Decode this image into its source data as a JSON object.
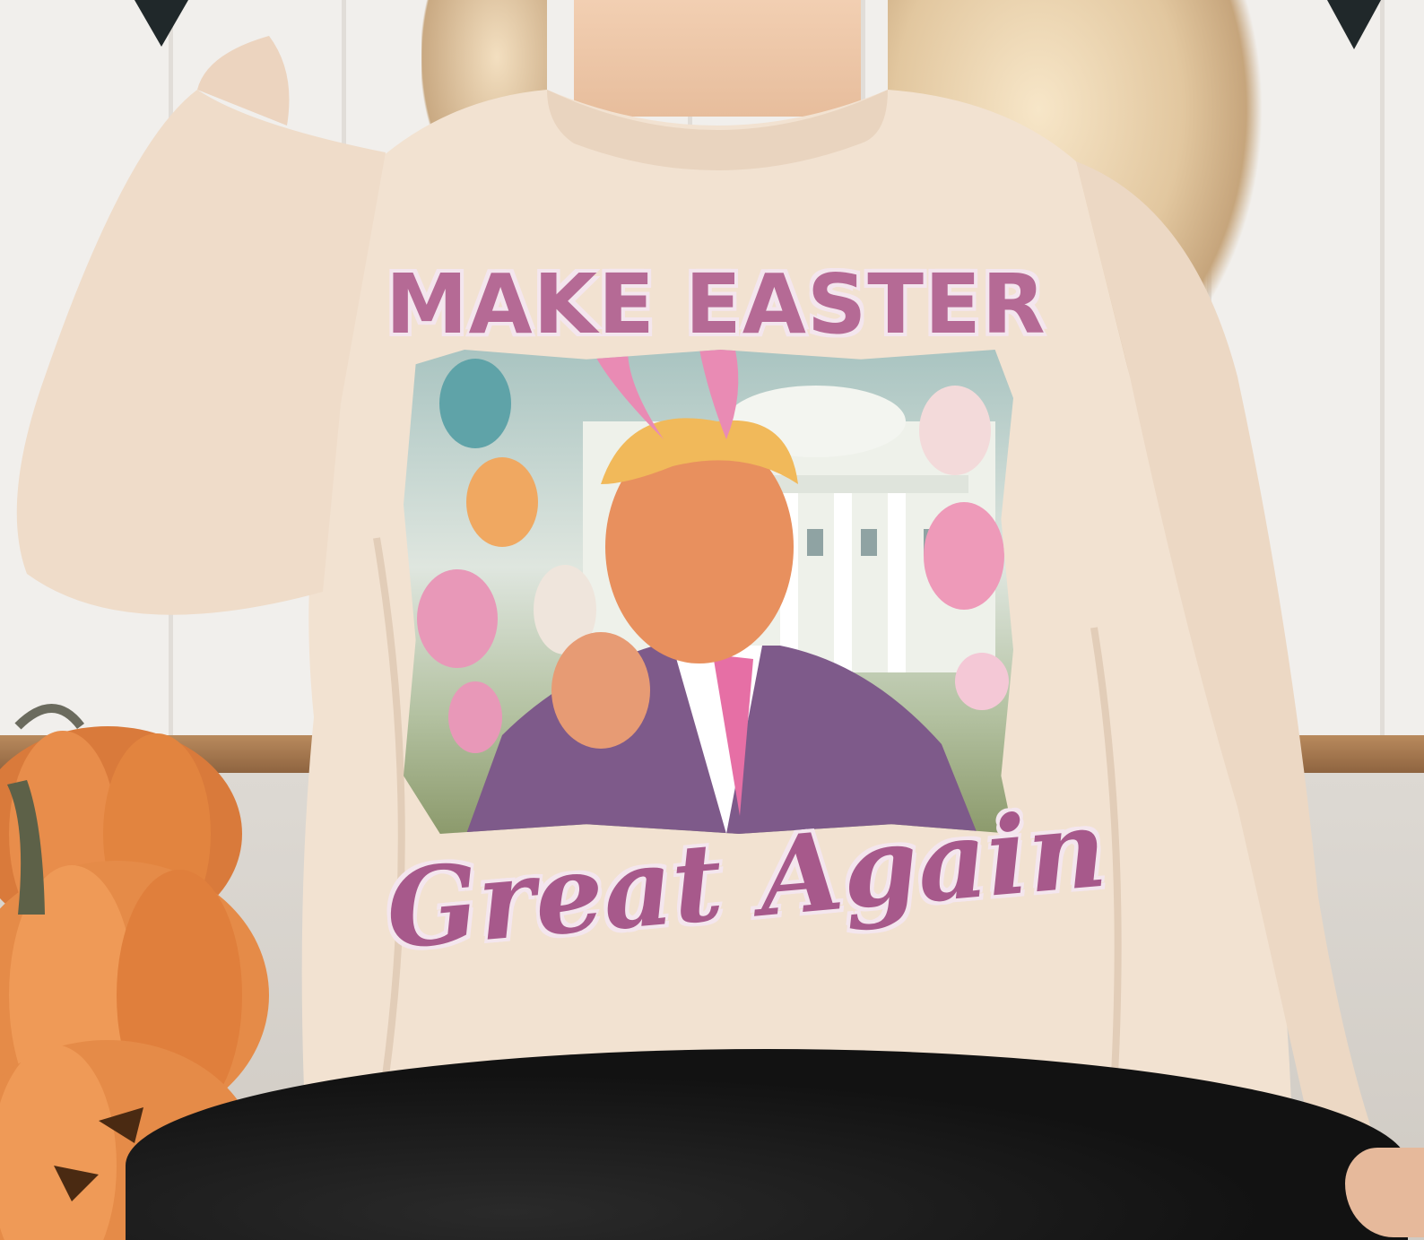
{
  "print": {
    "headline": "MAKE EASTER",
    "script_line": "Great Again"
  },
  "colors": {
    "sweatshirt": "#f2e2d1",
    "print_text_pink": "#b56a95",
    "pumpkin": "#e58b48",
    "leggings": "#151515"
  }
}
